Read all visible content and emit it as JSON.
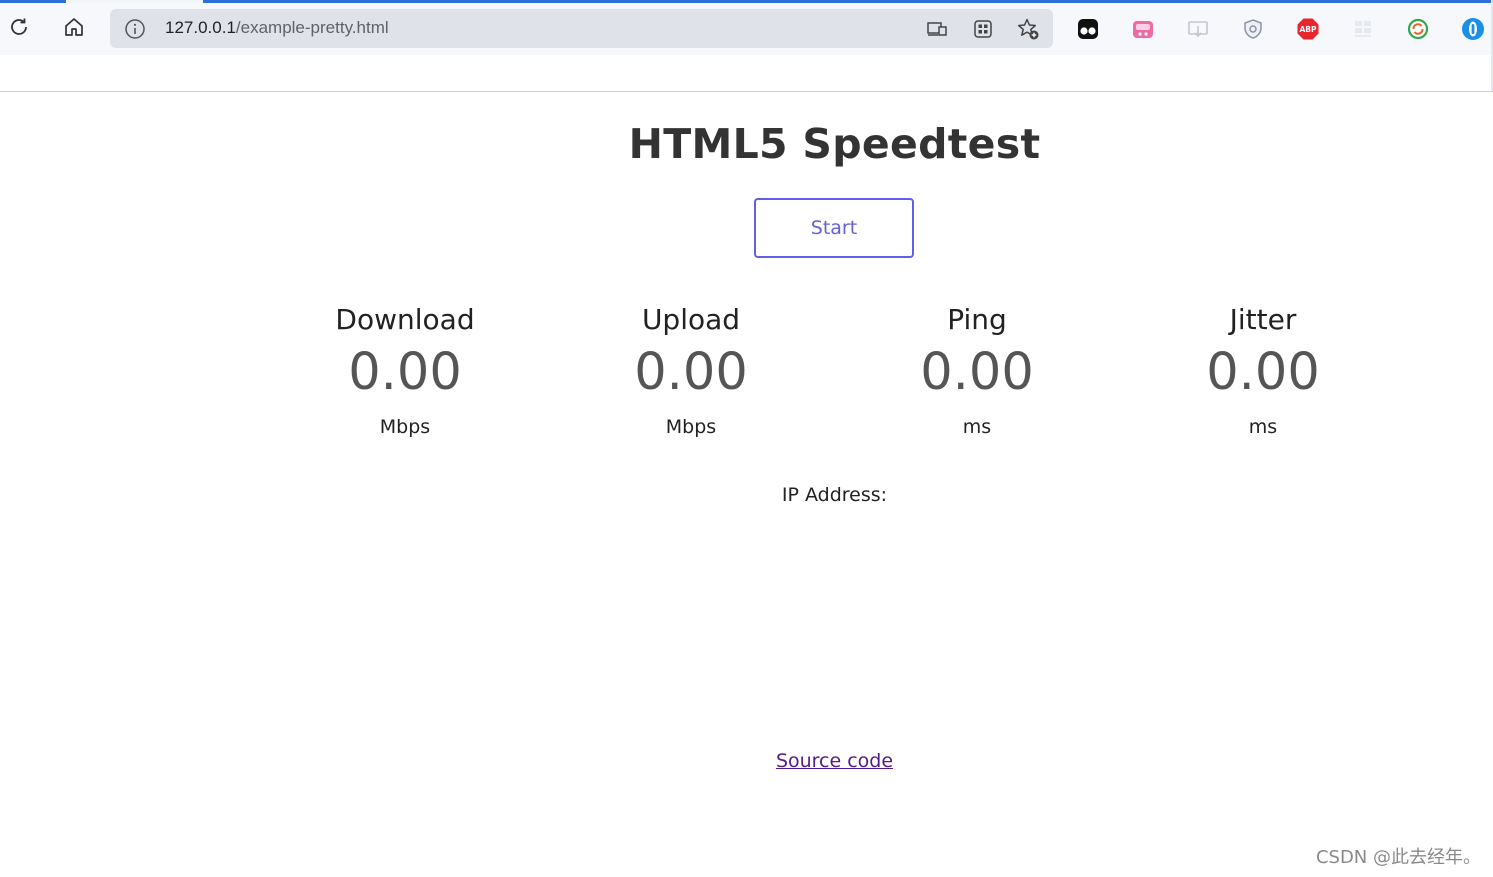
{
  "browser": {
    "url_host": "127.0.0.1",
    "url_path": "/example-pretty.html",
    "icons": {
      "reload": "reload-icon",
      "home": "home-icon",
      "site_info": "info-icon",
      "cast": "cast-icon",
      "apps": "apps-icon",
      "favorite": "favorite-add-icon"
    },
    "extensions": [
      {
        "name": "tampermonkey-extension-icon",
        "color": "#111111"
      },
      {
        "name": "pink-extension-icon",
        "color": "#f06aa5"
      },
      {
        "name": "download-extension-icon",
        "color": "#c9ccd2"
      },
      {
        "name": "shield-extension-icon",
        "color": "#8b93a6"
      },
      {
        "name": "abp-extension-icon",
        "color": "#e8262d",
        "text": "ABP"
      },
      {
        "name": "grid-extension-icon",
        "color": "#e0e3ea"
      },
      {
        "name": "sync-extension-icon",
        "color": "#2fa84f"
      },
      {
        "name": "edge-profile-extension-icon",
        "color": "#1a8fe8"
      }
    ]
  },
  "page": {
    "title": "HTML5 Speedtest",
    "start_label": "Start",
    "metrics": [
      {
        "label": "Download",
        "value": "0.00",
        "unit": "Mbps"
      },
      {
        "label": "Upload",
        "value": "0.00",
        "unit": "Mbps"
      },
      {
        "label": "Ping",
        "value": "0.00",
        "unit": "ms"
      },
      {
        "label": "Jitter",
        "value": "0.00",
        "unit": "ms"
      }
    ],
    "ip_label": "IP Address:",
    "source_link": "Source code"
  },
  "watermark": "CSDN @此去经年。",
  "colors": {
    "accent": "#6060e8",
    "link_visited": "#551a8b",
    "tab_indicator": "#2c6fd6"
  }
}
